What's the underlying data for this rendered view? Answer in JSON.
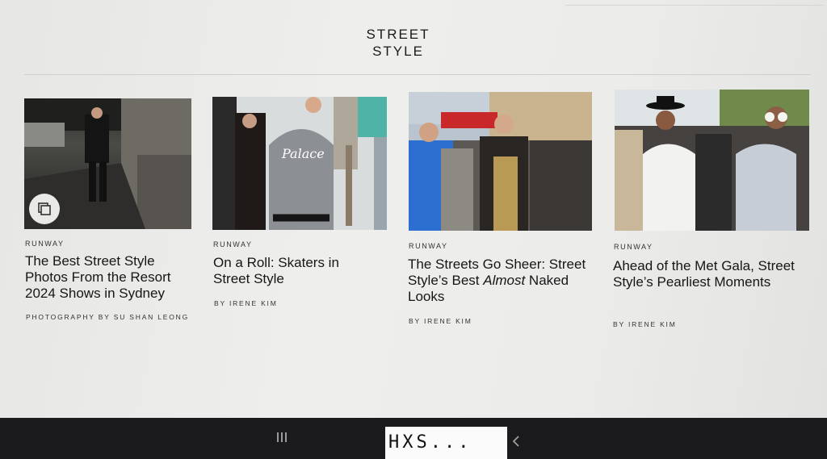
{
  "section": {
    "title": "STREET\nSTYLE"
  },
  "articles": [
    {
      "kicker": "RUNWAY",
      "headline": "The Best Street Style Photos From the Resort 2024 Shows in Sydney",
      "byline": "PHOTOGRAPHY BY SU SHAN LEONG",
      "image_alt": "Man in dark suit walking on runway",
      "has_gallery_icon": true
    },
    {
      "kicker": "RUNWAY",
      "headline": "On a Roll: Skaters in Street Style",
      "byline": "BY IRENE KIM",
      "image_alt": "Person wearing Palace jacket",
      "jacket_text": "Palace"
    },
    {
      "kicker": "RUNWAY",
      "headline_part1": "The Streets Go Sheer: Street Style’s Best ",
      "headline_em": "Almost",
      "headline_part2": " Naked Looks",
      "byline": "BY IRENE KIM",
      "image_alt": "Street style crowd in Paris"
    },
    {
      "kicker": "RUNWAY",
      "headline": "Ahead of the Met Gala, Street Style’s Pearliest Moments",
      "byline": "BY IRENE KIM",
      "image_alt": "Women wearing pearls and hats"
    }
  ],
  "icons": {
    "gallery": "gallery-icon",
    "recents": "recents-icon",
    "back": "back-icon"
  },
  "watermark": "HXS...",
  "colors": {
    "background": "#ececea",
    "text": "#161616",
    "taskbar": "#1b1b1d"
  }
}
